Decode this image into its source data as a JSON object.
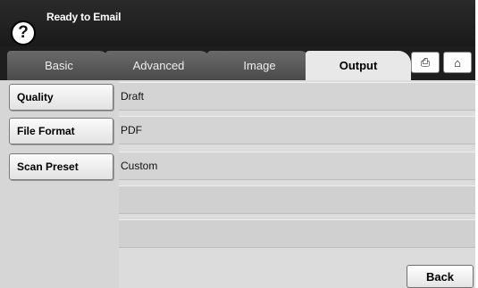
{
  "header": {
    "help_symbol": "?",
    "title": "Ready to Email"
  },
  "tabs": [
    {
      "label": "Basic",
      "active": false
    },
    {
      "label": "Advanced",
      "active": false
    },
    {
      "label": "Image",
      "active": false
    },
    {
      "label": "Output",
      "active": true
    }
  ],
  "tab_icons": {
    "job_icon": "job-status-icon",
    "home_icon": "home-icon",
    "job_glyph": "⎙",
    "home_glyph": "⌂"
  },
  "options": [
    {
      "label": "Quality",
      "value": "Draft"
    },
    {
      "label": "File Format",
      "value": "PDF"
    },
    {
      "label": "Scan Preset",
      "value": "Custom"
    }
  ],
  "footer": {
    "back_label": "Back"
  }
}
